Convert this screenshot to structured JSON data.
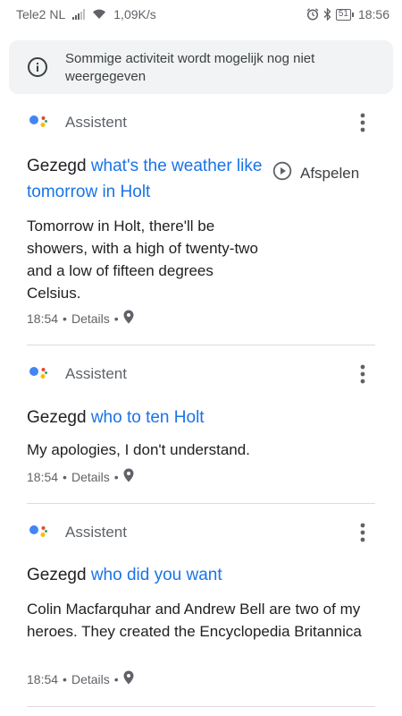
{
  "status_bar": {
    "carrier": "Tele2 NL",
    "data_speed": "1,09K/s",
    "battery_level": "51",
    "time": "18:56",
    "icons": [
      "signal-icon",
      "wifi-icon",
      "alarm-icon",
      "bluetooth-icon",
      "battery-icon"
    ]
  },
  "banner": {
    "icon": "info-icon",
    "text": "Sommige activiteit wordt mogelijk nog niet weergegeven"
  },
  "entries": [
    {
      "source": "Assistent",
      "query_prefix": "Gezegd",
      "query_text": "what's the weather like tomorrow in Holt",
      "play_label": "Afspelen",
      "response": "Tomorrow in Holt, there'll be showers, with a high of twenty-two and a low of fifteen degrees Celsius.",
      "time": "18:54",
      "details_label": "Details"
    },
    {
      "source": "Assistent",
      "query_prefix": "Gezegd",
      "query_text": "who to ten Holt",
      "response": "My apologies, I don't understand.",
      "time": "18:54",
      "details_label": "Details"
    },
    {
      "source": "Assistent",
      "query_prefix": "Gezegd",
      "query_text": "who did you want",
      "response": "Colin Macfarquhar and Andrew Bell are two of my heroes. They created the Encyclopedia Britannica",
      "time": "18:54",
      "details_label": "Details"
    }
  ],
  "colors": {
    "link_blue": "#1a73e8",
    "text_secondary": "#5f6368",
    "banner_bg": "#f1f3f4",
    "assistant_blue": "#4285f4",
    "assistant_red": "#ea4335",
    "assistant_yellow": "#fbbc04",
    "assistant_green": "#34a853"
  }
}
